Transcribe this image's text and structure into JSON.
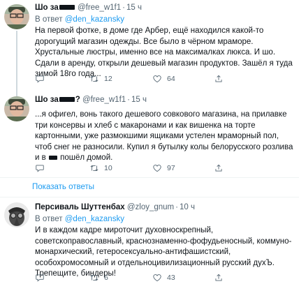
{
  "tweets": [
    {
      "author": "Шо за",
      "author_suffix": "",
      "handle": "@free_w1f1",
      "time": "15 ч",
      "reply_prefix": "В ответ",
      "reply_to": "@den_kazansky",
      "text": "На первой фотке, в доме где Арбер, ещё находился какой-то дорогущий магазин одежды. Все было в чёрном мраморе. Хрустальные люстры, именно все на максималках люкса. И шо. Сдали в аренду, открыли дешевый магазин продуктов. Зашёл я туда зимой 18го года...",
      "retweets": "12",
      "likes": "64"
    },
    {
      "author": "Шо за",
      "author_suffix": "?",
      "handle": "@free_w1f1",
      "time": "15 ч",
      "text_before": "...я офигел, вонь такого дешевого совкового магазина, на прилавке три консервы и хлеб с макаронами и как вишенка на торте картонными, уже размокшими ящиками устелен мраморный пол, чтоб снег не разносили. Купил я бутылку колы белорусского розлива и в",
      "text_after": "пошёл домой.",
      "retweets": "10",
      "likes": "97"
    },
    {
      "author": "Персиваль Шуттенбах",
      "handle": "@zloy_gnum",
      "time": "10 ч",
      "reply_prefix": "В ответ",
      "reply_to": "@den_kazansky",
      "text": "И в каждом кадре мироточит духовноскрепный, советскоправославный, краснознаменно-фофудьеносный, коммуно-монархический, гетеросексуально-антифашистский, особохромосомный и отдельноцивилизационный русский духЪ. Трепещите, биндеры!",
      "retweets": "6",
      "likes": "43"
    }
  ],
  "show_replies_label": "Показать ответы",
  "colors": {
    "accent": "#1d9bf0",
    "secondary_text": "#536471",
    "divider": "#eff3f4"
  }
}
